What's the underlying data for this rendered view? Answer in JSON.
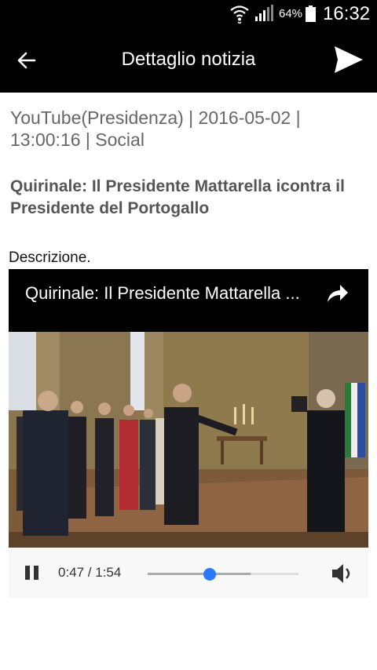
{
  "status_bar": {
    "battery_percent": "64%",
    "time": "16:32"
  },
  "app_bar": {
    "title": "Dettaglio notizia",
    "back_icon": "arrow-back-icon",
    "send_icon": "send-icon"
  },
  "article": {
    "meta": "YouTube(Presidenza) | 2016-05-02 | 13:00:16 | Social",
    "headline": "Quirinale: Il Presidente Mattarella icontra il Presidente del Portogallo",
    "description_label": "Descrizione."
  },
  "video_player": {
    "title": "Quirinale: Il Presidente Mattarella ...",
    "share_icon": "share-arrow-icon",
    "time_display": "0:47 / 1:54",
    "progress_fraction": 0.412,
    "buffered_fraction": 0.68,
    "play_state_icon": "pause-icon",
    "volume_icon": "volume-icon",
    "accent_color": "#2979ff"
  }
}
